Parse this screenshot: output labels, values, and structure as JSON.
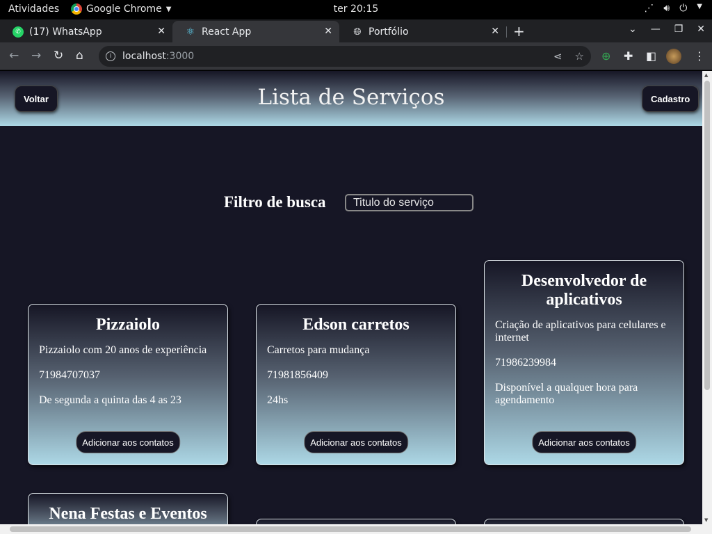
{
  "os": {
    "activities": "Atividades",
    "app_name": "Google Chrome",
    "clock": "ter 20:15"
  },
  "browser": {
    "tabs": [
      {
        "label": "(17) WhatsApp",
        "badge": "17"
      },
      {
        "label": "React App"
      },
      {
        "label": "Portfólio"
      }
    ],
    "url_host": "localhost",
    "url_port": ":3000"
  },
  "page": {
    "title": "Lista de Serviços",
    "back_button": "Voltar",
    "register_button": "Cadastro",
    "filter_label": "Filtro de busca",
    "filter_placeholder": "Titulo do serviço",
    "cards": [
      {
        "title": "Pizzaiolo",
        "description": "Pizzaiolo com 20 anos de experiência",
        "phone": "71984707037",
        "availability": "De segunda a quinta das 4 as 23",
        "button": "Adicionar aos contatos"
      },
      {
        "title": "Edson carretos",
        "description": "Carretos para mudança",
        "phone": "71981856409",
        "availability": "24hs",
        "button": "Adicionar aos contatos"
      },
      {
        "title": "Desenvolvedor de aplicativos",
        "description": "Criação de aplicativos para celulares e internet",
        "phone": "71986239984",
        "availability": "Disponível a qualquer hora para agendamento",
        "button": "Adicionar aos contatos"
      },
      {
        "title": "Nena Festas e Eventos"
      }
    ]
  },
  "colors": {
    "page_background": "#161625",
    "gradient_end": "#add8e6"
  }
}
